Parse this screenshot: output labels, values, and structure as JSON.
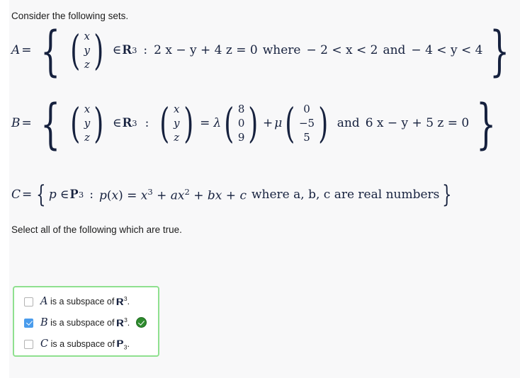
{
  "page": {
    "background_color": "#f8f8f9",
    "intro_text": "Consider the following sets.",
    "instruction_text": "Select all of the following which are true."
  },
  "sets": {
    "A": {
      "name": "A",
      "vector_entries": [
        "x",
        "y",
        "z"
      ],
      "space": "R",
      "space_exponent": "3",
      "condition_equation": "2 x − y + 4 z = 0",
      "where_label": "where",
      "constraint_1": "− 2 < x < 2",
      "and_label": "and",
      "constraint_2": "− 4 < y < 4"
    },
    "B": {
      "name": "B",
      "vector_entries": [
        "x",
        "y",
        "z"
      ],
      "space": "R",
      "space_exponent": "3",
      "lhs_entries": [
        "x",
        "y",
        "z"
      ],
      "scalar_1": "λ",
      "vector_1": [
        "8",
        "0",
        "9"
      ],
      "plus": "+",
      "scalar_2": "μ",
      "vector_2": [
        "0",
        "−5",
        "5"
      ],
      "and_label": "and",
      "condition_equation": "6 x − y + 5 z = 0"
    },
    "C": {
      "name": "C",
      "member": "p",
      "space": "P",
      "space_subscript": "3",
      "polynomial": "p(x) = x³ + ax² + bx + c",
      "where_text": "where a, b, c are real numbers"
    }
  },
  "answers": {
    "border_color": "#8fe08f",
    "checked_color": "#4a9cec",
    "badge_color": "#2e8b2e",
    "options": [
      {
        "id": "option-a",
        "checked": false,
        "text_prefix": "A",
        "text_middle": " is a subspace of ",
        "space": "R",
        "space_exponent": "3",
        "text_suffix": ".",
        "correct_badge": false
      },
      {
        "id": "option-b",
        "checked": true,
        "text_prefix": "B",
        "text_middle": " is a subspace of ",
        "space": "R",
        "space_exponent": "3",
        "text_suffix": ".",
        "correct_badge": true
      },
      {
        "id": "option-c",
        "checked": false,
        "text_prefix": "C",
        "text_middle": " is a subspace of ",
        "space": "P",
        "space_subscript": "3",
        "text_suffix": ".",
        "correct_badge": false
      }
    ]
  }
}
